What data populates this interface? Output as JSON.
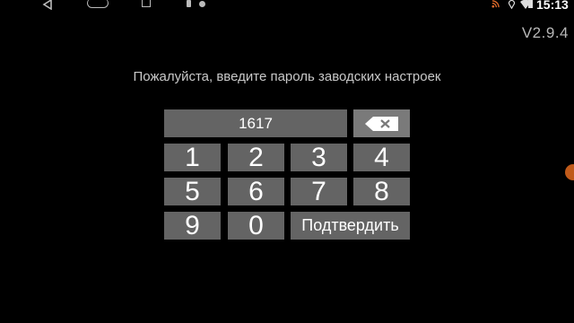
{
  "status_bar": {
    "time": "15:13",
    "nav_icons": [
      "back-icon",
      "home-icon",
      "recent-apps-icon"
    ],
    "notification_icons": [
      "usb-icon",
      "record-dot-icon"
    ],
    "status_icons": [
      "rss-icon",
      "location-icon",
      "wifi-icon",
      "battery-icon"
    ]
  },
  "app": {
    "version": "V2.9.4",
    "prompt": "Пожалуйста, введите пароль заводских настроек"
  },
  "keypad": {
    "input_value": "1617",
    "keys": {
      "k1": "1",
      "k2": "2",
      "k3": "3",
      "k4": "4",
      "k5": "5",
      "k6": "6",
      "k7": "7",
      "k8": "8",
      "k9": "9",
      "k0": "0"
    },
    "confirm_label": "Подтвердить"
  },
  "colors": {
    "background": "#000000",
    "key": "#646464",
    "backspace": "#7a7a7a",
    "text": "#ffffff",
    "accent_dot": "#c05a1a"
  }
}
